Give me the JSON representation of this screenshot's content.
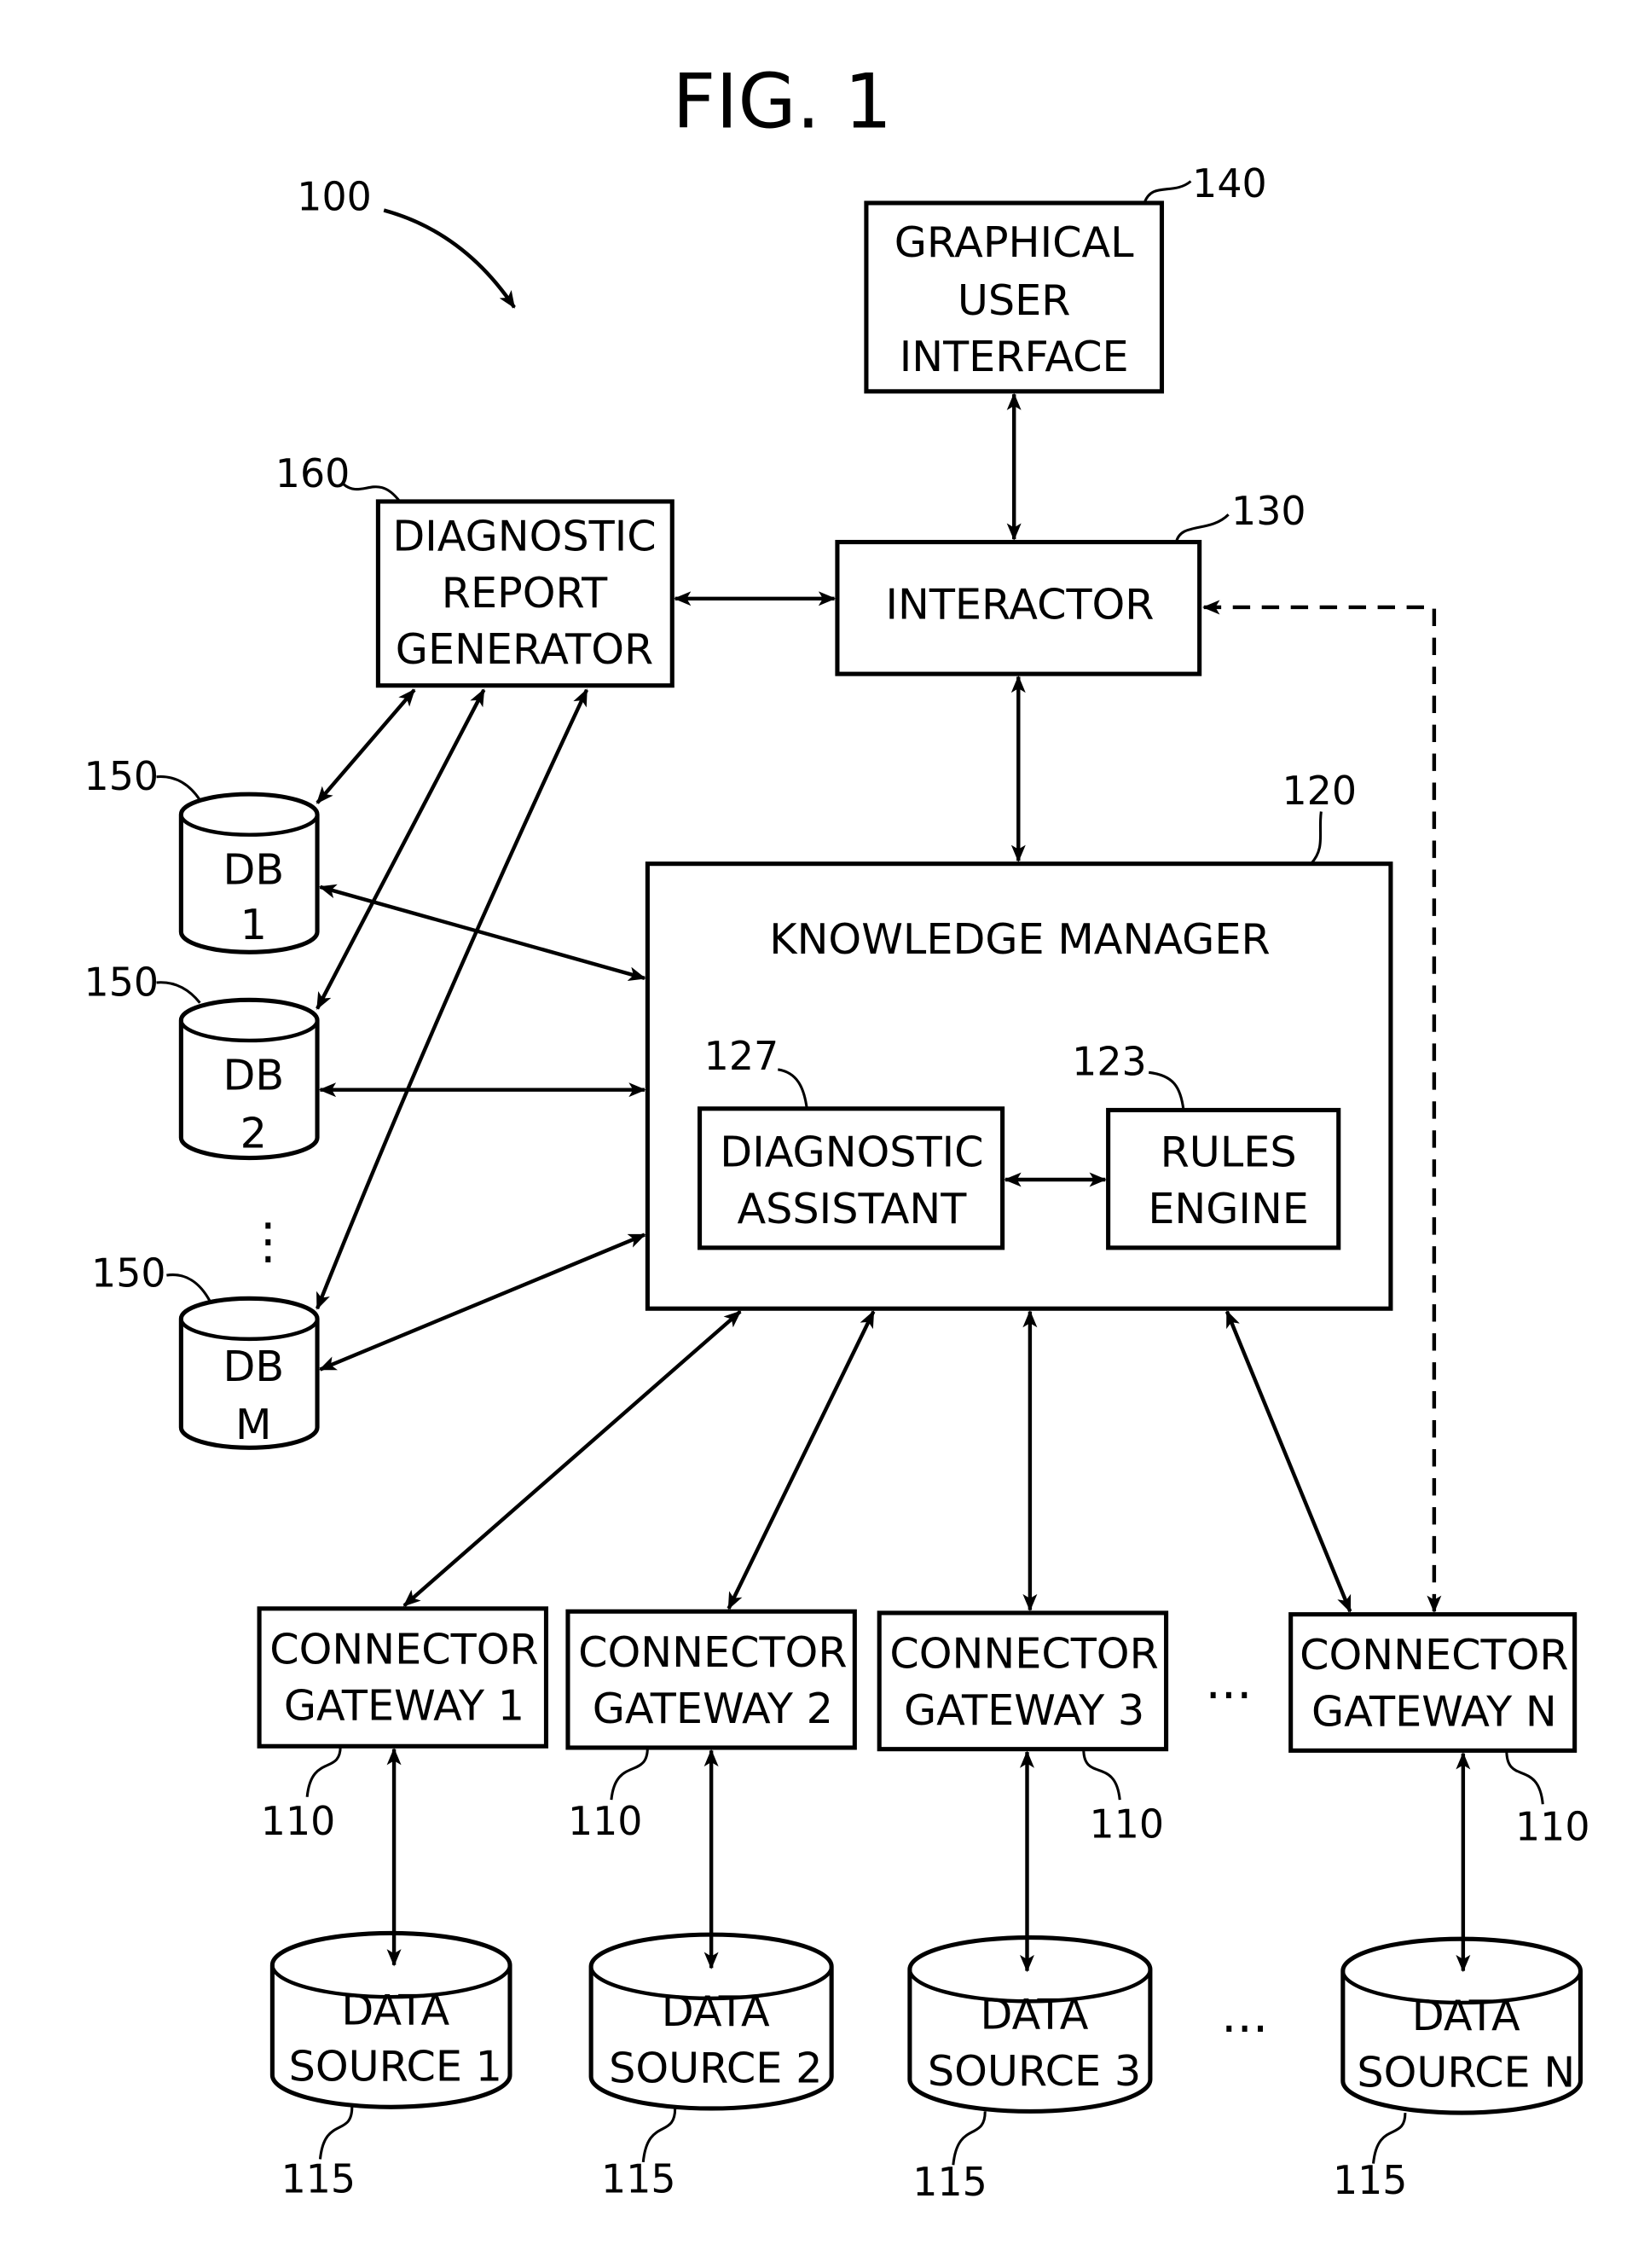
{
  "figure": {
    "title": "FIG. 1",
    "system_ref": "100"
  },
  "gui": {
    "ref": "140",
    "lines": [
      "GRAPHICAL",
      "USER",
      "INTERFACE"
    ]
  },
  "interactor": {
    "ref": "130",
    "lines": [
      "INTERACTOR"
    ]
  },
  "report_generator": {
    "ref": "160",
    "lines": [
      "DIAGNOSTIC",
      "REPORT",
      "GENERATOR"
    ]
  },
  "knowledge_manager": {
    "ref": "120",
    "title": "KNOWLEDGE MANAGER",
    "diagnostic_assistant": {
      "ref": "127",
      "lines": [
        "DIAGNOSTIC",
        "ASSISTANT"
      ]
    },
    "rules_engine": {
      "ref": "123",
      "lines": [
        "RULES",
        "ENGINE"
      ]
    }
  },
  "databases": [
    {
      "ref": "150",
      "lines": [
        "DB",
        "1"
      ]
    },
    {
      "ref": "150",
      "lines": [
        "DB",
        "2"
      ]
    },
    {
      "ref": "150",
      "lines": [
        "DB",
        "M"
      ]
    }
  ],
  "db_ellipsis": "⋮",
  "gateways": [
    {
      "ref": "110",
      "lines": [
        "CONNECTOR",
        "GATEWAY 1"
      ]
    },
    {
      "ref": "110",
      "lines": [
        "CONNECTOR",
        "GATEWAY 2"
      ]
    },
    {
      "ref": "110",
      "lines": [
        "CONNECTOR",
        "GATEWAY 3"
      ]
    },
    {
      "ref": "110",
      "lines": [
        "CONNECTOR",
        "GATEWAY N"
      ]
    }
  ],
  "gateway_ellipsis": "...",
  "data_sources": [
    {
      "ref": "115",
      "lines": [
        "DATA",
        "SOURCE 1"
      ]
    },
    {
      "ref": "115",
      "lines": [
        "DATA",
        "SOURCE 2"
      ]
    },
    {
      "ref": "115",
      "lines": [
        "DATA",
        "SOURCE 3"
      ]
    },
    {
      "ref": "115",
      "lines": [
        "DATA",
        "SOURCE N"
      ]
    }
  ],
  "data_source_ellipsis": "..."
}
